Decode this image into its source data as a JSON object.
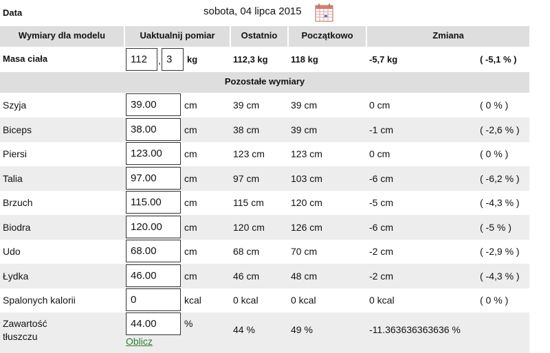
{
  "header": {
    "date_label": "Data",
    "date_value": "sobota, 04 lipca 2015",
    "calendar_icon": "calendar-icon"
  },
  "columns": [
    "Wymiary dla modelu",
    "Uaktualnij pomiar",
    "Ostatnio",
    "Początkowo",
    "Zmiana"
  ],
  "mass": {
    "label": "Masa ciała",
    "value_int": "112",
    "separator": ",",
    "value_dec": "3",
    "unit": "kg",
    "last": "112,3 kg",
    "initial": "118 kg",
    "change": "-5,7 kg",
    "change_pct": "( -5,1 % )"
  },
  "section_title": "Pozostałe wymiary",
  "measurements": [
    {
      "label": "Szyja",
      "value": "39.00",
      "unit": "cm",
      "last": "39 cm",
      "initial": "39 cm",
      "change": "0 cm",
      "pct": "( 0 % )"
    },
    {
      "label": "Biceps",
      "value": "38.00",
      "unit": "cm",
      "last": "38 cm",
      "initial": "39 cm",
      "change": "-1 cm",
      "pct": "( -2,6 % )"
    },
    {
      "label": "Piersi",
      "value": "123.00",
      "unit": "cm",
      "last": "123 cm",
      "initial": "123 cm",
      "change": "0 cm",
      "pct": "( 0 % )"
    },
    {
      "label": "Talia",
      "value": "97.00",
      "unit": "cm",
      "last": "97 cm",
      "initial": "103 cm",
      "change": "-6 cm",
      "pct": "( -6,2 % )"
    },
    {
      "label": "Brzuch",
      "value": "115.00",
      "unit": "cm",
      "last": "115 cm",
      "initial": "120 cm",
      "change": "-5 cm",
      "pct": "( -4,3 % )"
    },
    {
      "label": "Biodra",
      "value": "120.00",
      "unit": "cm",
      "last": "120 cm",
      "initial": "126 cm",
      "change": "-6 cm",
      "pct": "( -5 % )"
    },
    {
      "label": "Udo",
      "value": "68.00",
      "unit": "cm",
      "last": "68 cm",
      "initial": "70 cm",
      "change": "-2 cm",
      "pct": "( -2,9 % )"
    },
    {
      "label": "Łydka",
      "value": "46.00",
      "unit": "cm",
      "last": "46 cm",
      "initial": "48 cm",
      "change": "-2 cm",
      "pct": "( -4,3 % )"
    },
    {
      "label": "Spalonych kalorii",
      "value": "0",
      "unit": "kcal",
      "last": "0 kcal",
      "initial": "0 kcal",
      "change": "0 kcal",
      "pct": "( 0 % )"
    }
  ],
  "fat": {
    "label_line1": "Zawartość",
    "label_line2": "tłuszczu",
    "value": "44.00",
    "unit": "%",
    "last": "44 %",
    "initial": "49 %",
    "change": "-11.363636363636 %",
    "calc_link": "Oblicz"
  }
}
